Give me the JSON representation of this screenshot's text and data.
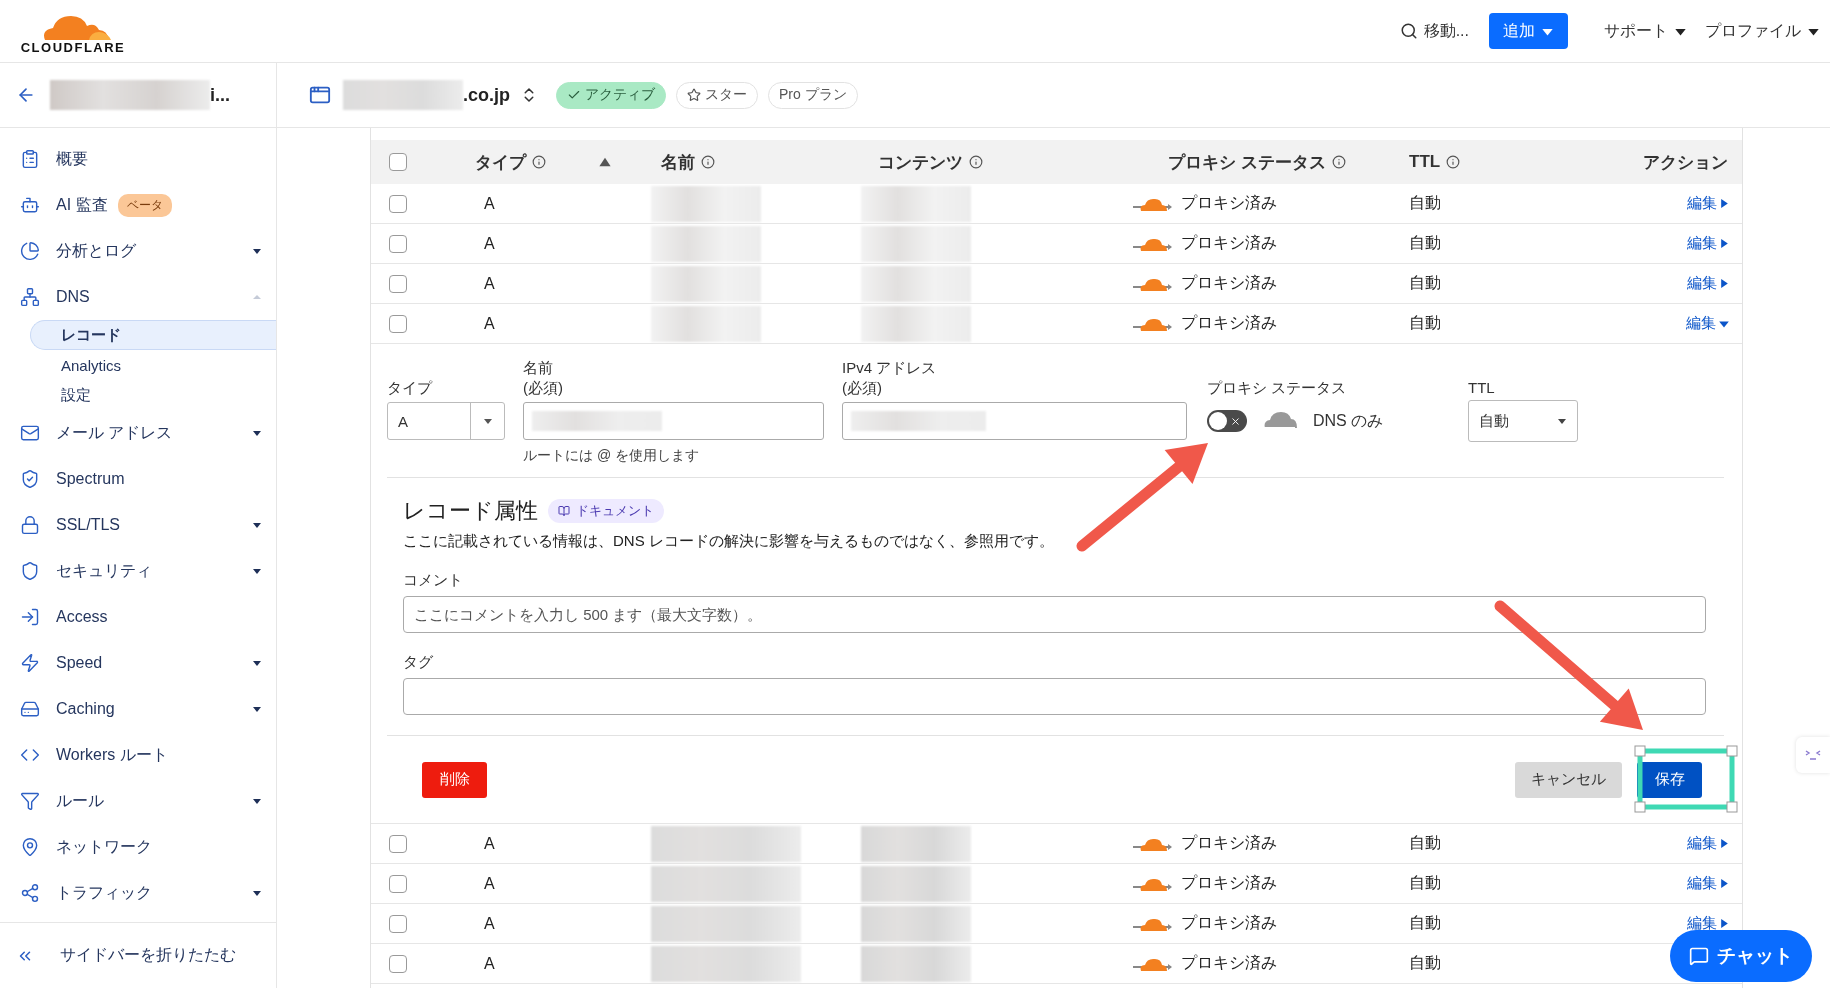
{
  "header": {
    "logo": "CLOUDFLARE",
    "search": "移動...",
    "add_button": "追加",
    "menus": [
      "サポート",
      "プロファイル"
    ]
  },
  "zone_bar": {
    "account": "i...",
    "domain": ".co.jp",
    "status": "アクティブ",
    "star": "スター",
    "plan": "Pro プラン"
  },
  "sidebar": {
    "items": [
      {
        "label": "概要",
        "expandable": false
      },
      {
        "label": "AI 監査",
        "badge": "ベータ",
        "expandable": false
      },
      {
        "label": "分析とログ",
        "expandable": true,
        "expanded": false
      },
      {
        "label": "DNS",
        "expandable": true,
        "expanded": true,
        "children": [
          {
            "label": "レコード",
            "selected": true
          },
          {
            "label": "Analytics",
            "selected": false
          },
          {
            "label": "設定",
            "selected": false
          }
        ]
      },
      {
        "label": "メール アドレス",
        "expandable": true,
        "expanded": false
      },
      {
        "label": "Spectrum",
        "expandable": false
      },
      {
        "label": "SSL/TLS",
        "expandable": true,
        "expanded": false
      },
      {
        "label": "セキュリティ",
        "expandable": true,
        "expanded": false
      },
      {
        "label": "Access",
        "expandable": false
      },
      {
        "label": "Speed",
        "expandable": true,
        "expanded": false
      },
      {
        "label": "Caching",
        "expandable": true,
        "expanded": false
      },
      {
        "label": "Workers ルート",
        "expandable": false
      },
      {
        "label": "ルール",
        "expandable": true,
        "expanded": false
      },
      {
        "label": "ネットワーク",
        "expandable": false
      },
      {
        "label": "トラフィック",
        "expandable": true,
        "expanded": false
      }
    ],
    "collapse": "サイドバーを折りたたむ"
  },
  "table": {
    "select_all": {
      "checked": false
    },
    "columns": [
      {
        "label": "タイプ",
        "info": true,
        "sorted": true
      },
      {
        "label": "名前",
        "info": true,
        "sorted": false
      },
      {
        "label": "コンテンツ",
        "info": true,
        "sorted": false
      },
      {
        "label": "プロキシ ステータス",
        "info": true,
        "sorted": false
      },
      {
        "label": "TTL",
        "info": true,
        "sorted": false
      },
      {
        "label": "アクション",
        "info": false,
        "sorted": false
      }
    ],
    "rows": [
      {
        "checked": false,
        "type": "A",
        "proxy": "プロキシ済み",
        "ttl": "自動",
        "action": "編集",
        "expanded": false
      },
      {
        "checked": false,
        "type": "A",
        "proxy": "プロキシ済み",
        "ttl": "自動",
        "action": "編集",
        "expanded": false
      },
      {
        "checked": false,
        "type": "A",
        "proxy": "プロキシ済み",
        "ttl": "自動",
        "action": "編集",
        "expanded": false
      },
      {
        "checked": false,
        "type": "A",
        "proxy": "プロキシ済み",
        "ttl": "自動",
        "action": "編集",
        "expanded": true
      },
      {
        "checked": false,
        "type": "A",
        "proxy": "プロキシ済み",
        "ttl": "自動",
        "action": "編集",
        "expanded": false
      },
      {
        "checked": false,
        "type": "A",
        "proxy": "プロキシ済み",
        "ttl": "自動",
        "action": "編集",
        "expanded": false
      },
      {
        "checked": false,
        "type": "A",
        "proxy": "プロキシ済み",
        "ttl": "自動",
        "action": "編集",
        "expanded": false
      },
      {
        "checked": false,
        "type": "A",
        "proxy": "プロキシ済み",
        "ttl": "自動",
        "expanded": false
      }
    ]
  },
  "editor": {
    "type": {
      "label": "タイプ",
      "value": "A"
    },
    "name": {
      "label": "名前",
      "required": "(必須)",
      "hint": "ルートには @ を使用します"
    },
    "ipv4": {
      "label": "IPv4 アドレス",
      "required": "(必須)"
    },
    "proxy": {
      "label": "プロキシ ステータス",
      "on": false,
      "text": "DNS のみ"
    },
    "ttl": {
      "label": "TTL",
      "value": "自動"
    },
    "attributes": {
      "title": "レコード属性",
      "doc_link": "ドキュメント",
      "description": "ここに記載されている情報は、DNS レコードの解決に影響を与えるものではなく、参照用です。"
    },
    "comment": {
      "label": "コメント",
      "placeholder": "ここにコメントを入力し 500 ます（最大文字数）。"
    },
    "tag": {
      "label": "タグ"
    },
    "delete_button": "削除",
    "cancel_button": "キャンセル",
    "save_button": "保存"
  },
  "chat_button": "チャット"
}
